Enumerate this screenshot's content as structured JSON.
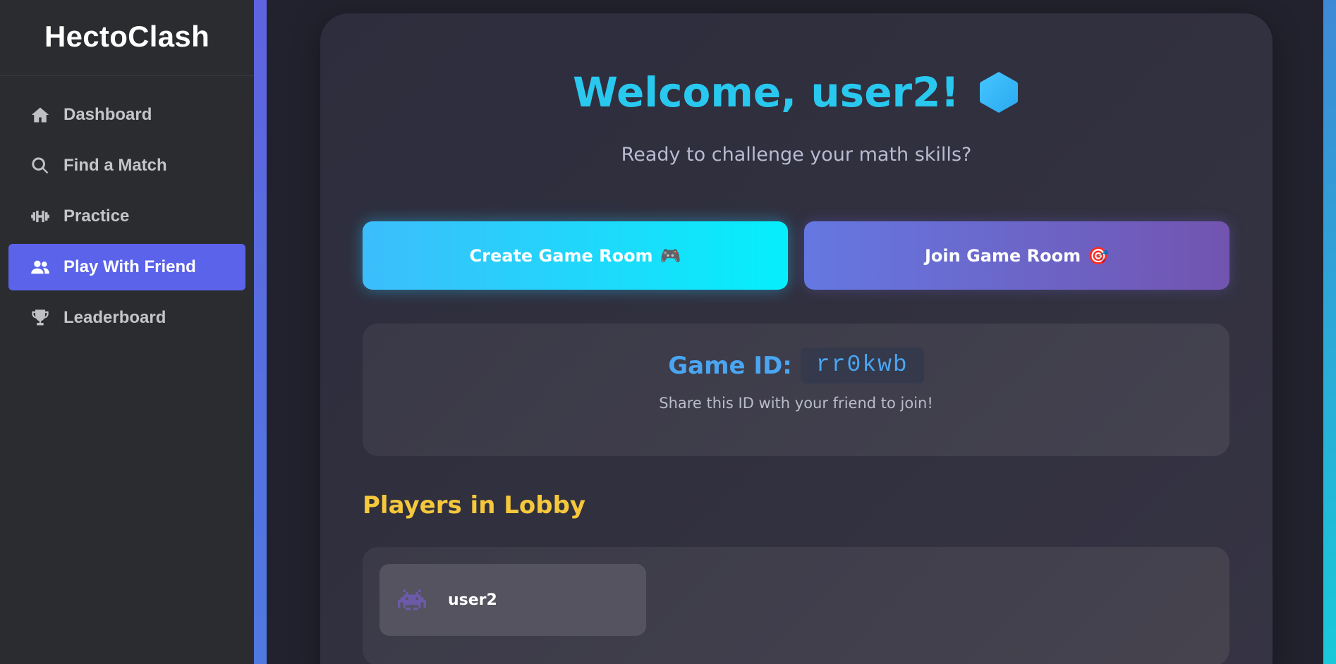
{
  "app": {
    "brand": "HectoClash"
  },
  "sidebar": {
    "items": [
      {
        "label": "Dashboard",
        "icon": "home-icon",
        "active": false
      },
      {
        "label": "Find a Match",
        "icon": "search-icon",
        "active": false
      },
      {
        "label": "Practice",
        "icon": "dumbbell-icon",
        "active": false
      },
      {
        "label": "Play With Friend",
        "icon": "users-icon",
        "active": true
      },
      {
        "label": "Leaderboard",
        "icon": "trophy-icon",
        "active": false
      }
    ]
  },
  "main": {
    "welcome": "Welcome, user2!",
    "welcome_icon": "hexagon-icon",
    "subtitle": "Ready to challenge your math skills?",
    "create_button": {
      "label": "Create Game Room",
      "emoji": "🎮"
    },
    "join_button": {
      "label": "Join Game Room",
      "emoji": "🎯"
    },
    "game_id": {
      "label": "Game ID:",
      "value": "rr0kwb",
      "hint": "Share this ID with your friend to join!"
    },
    "lobby": {
      "title": "Players in Lobby",
      "players": [
        {
          "name": "user2",
          "avatar": "alien-monster-icon"
        }
      ]
    }
  },
  "colors": {
    "accent": "#5b63eb",
    "welcome": "#29c8ef",
    "game_id": "#4aa6f2",
    "lobby_title": "#f5c83c",
    "create_gradient": [
      "#3dbdfb",
      "#05effb"
    ],
    "join_gradient": [
      "#6578e2",
      "#7254b0"
    ]
  }
}
